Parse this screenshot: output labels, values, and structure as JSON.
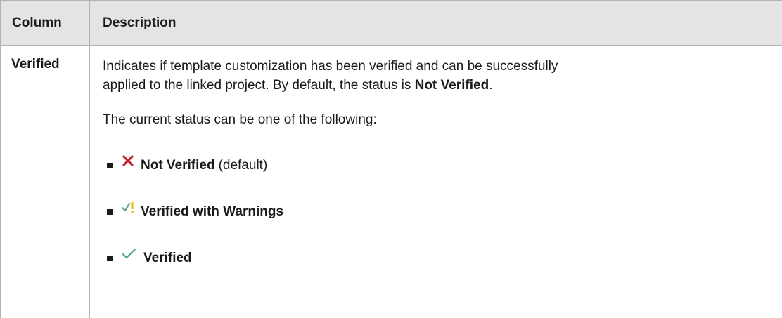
{
  "table": {
    "headers": {
      "column": "Column",
      "description": "Description"
    },
    "row": {
      "name": "Verified",
      "paragraph1_line1": "Indicates if template customization has been verified and can be successfully",
      "paragraph1_line2_prefix": "applied to the linked project. By default, the status is ",
      "paragraph1_line2_bold": "Not Verified",
      "paragraph1_line2_suffix": ".",
      "paragraph2": "The current status can be one of the following:",
      "statuses": [
        {
          "icon": "red-x-icon",
          "label": "Not Verified",
          "extra": "(default)"
        },
        {
          "icon": "check-warning-icon",
          "label": "Verified with Warnings",
          "extra": ""
        },
        {
          "icon": "green-check-icon",
          "label": "Verified",
          "extra": ""
        }
      ]
    }
  },
  "colors": {
    "header_bg": "#e4e4e4",
    "border": "#b3b3b3",
    "x_red": "#c0262d",
    "check_green": "#5aa57a",
    "warning_yellow": "#e6b800"
  }
}
